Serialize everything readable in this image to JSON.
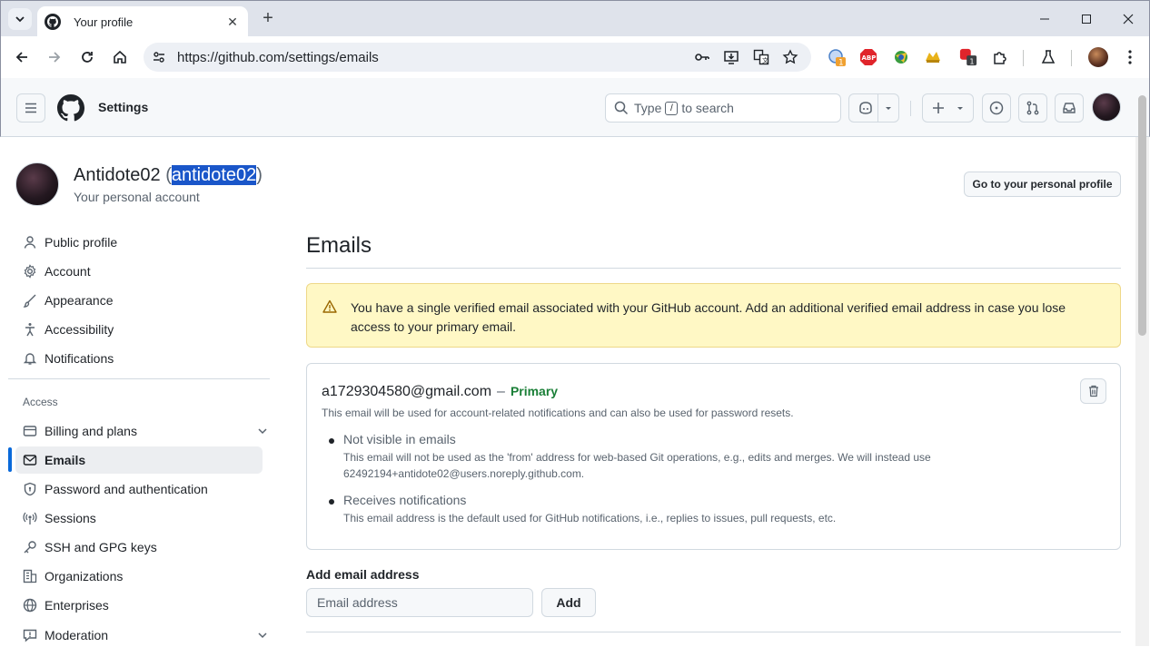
{
  "browser": {
    "tab_title": "Your profile",
    "url": "https://github.com/settings/emails",
    "ext_badge_1": "1",
    "ext_badge_2": "1",
    "abp_label": "ABP"
  },
  "header": {
    "title": "Settings",
    "search_prefix": "Type",
    "search_key": "/",
    "search_suffix": "to search"
  },
  "account": {
    "name": "Antidote02",
    "handle": "antidote02",
    "subtitle": "Your personal account",
    "profile_button": "Go to your personal profile"
  },
  "sidebar": {
    "items": [
      {
        "label": "Public profile",
        "icon": "person-icon"
      },
      {
        "label": "Account",
        "icon": "gear-icon"
      },
      {
        "label": "Appearance",
        "icon": "paintbrush-icon"
      },
      {
        "label": "Accessibility",
        "icon": "accessibility-icon"
      },
      {
        "label": "Notifications",
        "icon": "bell-icon"
      }
    ],
    "section_access": "Access",
    "access_items": [
      {
        "label": "Billing and plans",
        "icon": "credit-card-icon"
      },
      {
        "label": "Emails",
        "icon": "mail-icon"
      },
      {
        "label": "Password and authentication",
        "icon": "shield-lock-icon"
      },
      {
        "label": "Sessions",
        "icon": "broadcast-icon"
      },
      {
        "label": "SSH and GPG keys",
        "icon": "key-icon"
      },
      {
        "label": "Organizations",
        "icon": "organization-icon"
      },
      {
        "label": "Enterprises",
        "icon": "globe-icon"
      },
      {
        "label": "Moderation",
        "icon": "report-icon"
      }
    ]
  },
  "main": {
    "title": "Emails",
    "flash": "You have a single verified email associated with your GitHub account. Add an additional verified email address in case you lose access to your primary email.",
    "email": {
      "address": "a1729304580@gmail.com",
      "separator": "–",
      "primary_label": "Primary",
      "note": "This email will be used for account-related notifications and can also be used for password resets.",
      "bullets": [
        {
          "title": "Not visible in emails",
          "body": "This email will not be used as the 'from' address for web-based Git operations, e.g., edits and merges. We will instead use 62492194+antidote02@users.noreply.github.com."
        },
        {
          "title": "Receives notifications",
          "body": "This email address is the default used for GitHub notifications, i.e., replies to issues, pull requests, etc."
        }
      ]
    },
    "add_email": {
      "label": "Add email address",
      "placeholder": "Email address",
      "button": "Add"
    }
  },
  "colors": {
    "accent": "#0969da",
    "primary_green": "#1a7f37",
    "flash_bg": "#fff8c5",
    "selection": "#1a56c9"
  }
}
